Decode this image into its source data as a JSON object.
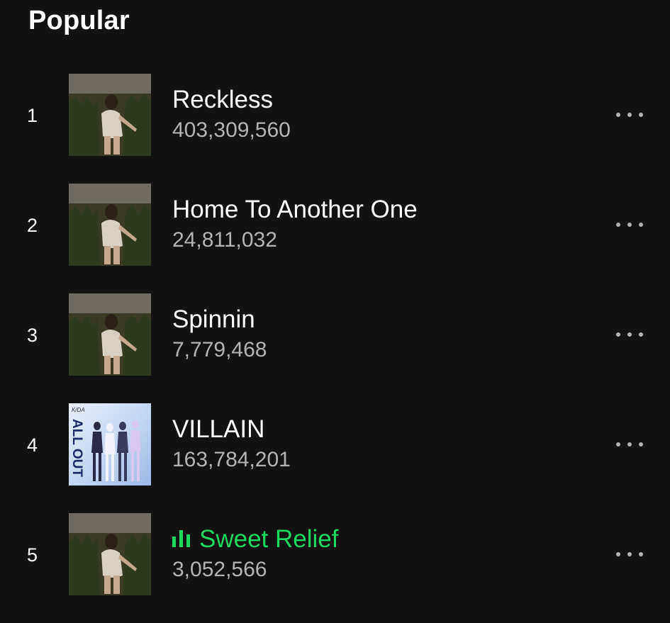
{
  "section": {
    "title": "Popular"
  },
  "tracks": [
    {
      "index": "1",
      "title": "Reckless",
      "plays": "403,309,560",
      "cover": "field-portrait",
      "playing": false
    },
    {
      "index": "2",
      "title": "Home To Another One",
      "plays": "24,811,032",
      "cover": "field-portrait",
      "playing": false
    },
    {
      "index": "3",
      "title": "Spinnin",
      "plays": "7,779,468",
      "cover": "field-portrait",
      "playing": false
    },
    {
      "index": "4",
      "title": "VILLAIN",
      "plays": "163,784,201",
      "cover": "kda-all-out",
      "cover_text": {
        "logo": "K/DA",
        "title": "ALL OUT"
      },
      "playing": false
    },
    {
      "index": "5",
      "title": "Sweet Relief",
      "plays": "3,052,566",
      "cover": "field-portrait",
      "playing": true
    }
  ],
  "icons": {
    "playing_indicator": "equalizer-bars-icon",
    "row_menu": "more-options-icon"
  },
  "colors": {
    "background": "#121212",
    "text_primary": "#ffffff",
    "text_secondary": "#b3b3b3",
    "accent_playing": "#1ed760"
  }
}
